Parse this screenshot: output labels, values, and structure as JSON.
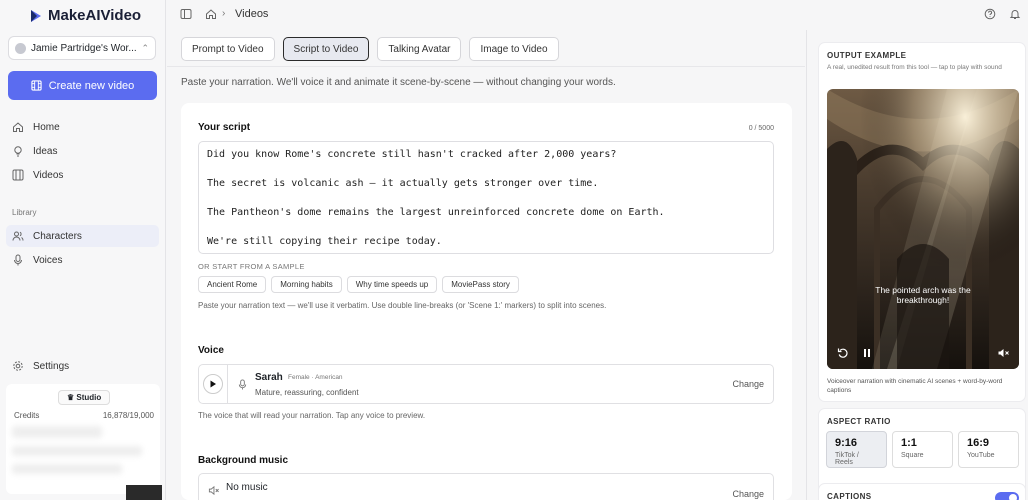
{
  "app": {
    "logo_text": "MakeAIVideo",
    "accent": "#5b6cf0"
  },
  "sidebar": {
    "workspace": "Jamie Partridge's Wor...",
    "create_label": "Create new video",
    "nav": [
      {
        "label": "Home",
        "icon": "home-icon"
      },
      {
        "label": "Ideas",
        "icon": "bulb-icon"
      },
      {
        "label": "Videos",
        "icon": "film-icon"
      }
    ],
    "library_label": "Library",
    "library": [
      {
        "label": "Characters",
        "icon": "users-icon",
        "active": true
      },
      {
        "label": "Voices",
        "icon": "mic-icon"
      }
    ],
    "settings_label": "Settings",
    "plan": {
      "badge": "Studio",
      "credits_label": "Credits",
      "credits_value": "16,878/19,000"
    }
  },
  "topbar": {
    "breadcrumb": "Videos"
  },
  "tabs": [
    "Prompt to Video",
    "Script to Video",
    "Talking Avatar",
    "Image to Video"
  ],
  "active_tab": 1,
  "subtitle": "Paste your narration. We'll voice it and animate it scene-by-scene — without changing your words.",
  "script": {
    "title": "Your script",
    "counter": "0 / 5000",
    "lines": [
      "Did you know Rome's concrete still hasn't cracked after 2,000 years?",
      "The secret is volcanic ash — it actually gets stronger over time.",
      "The Pantheon's dome remains the largest unreinforced concrete dome on Earth.",
      "We're still copying their recipe today."
    ],
    "sample_label": "OR START FROM A SAMPLE",
    "samples": [
      "Ancient Rome",
      "Morning habits",
      "Why time speeds up",
      "MoviePass story"
    ],
    "hint": "Paste your narration text — we'll use it verbatim. Use double line-breaks (or 'Scene 1:' markers) to split into scenes."
  },
  "voice": {
    "title": "Voice",
    "name": "Sarah",
    "meta": "Female · American",
    "description": "Mature, reassuring, confident",
    "change": "Change",
    "hint": "The voice that will read your narration. Tap any voice to preview."
  },
  "music": {
    "title": "Background music",
    "name": "No music",
    "change": "Change"
  },
  "output_example": {
    "title": "OUTPUT EXAMPLE",
    "subtitle": "A real, unedited result from this tool — tap to play with sound",
    "caption_line1": "The pointed arch was the",
    "caption_line2": "breakthrough!",
    "footer": "Voiceover narration with cinematic AI scenes + word-by-word captions"
  },
  "aspect_ratio": {
    "title": "ASPECT RATIO",
    "options": [
      {
        "value": "9:16",
        "label": "TikTok / Reels",
        "selected": true
      },
      {
        "value": "1:1",
        "label": "Square"
      },
      {
        "value": "16:9",
        "label": "YouTube"
      }
    ]
  },
  "captions": {
    "title": "CAPTIONS",
    "enabled": true
  }
}
